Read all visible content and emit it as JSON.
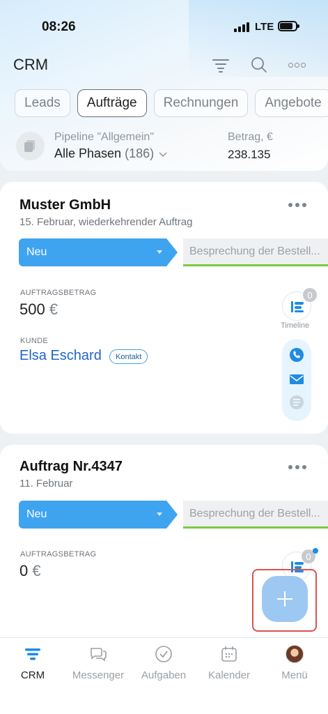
{
  "status_bar": {
    "time": "08:26",
    "network": "LTE"
  },
  "header": {
    "title": "CRM",
    "icons": {
      "filter": "filter-icon",
      "search": "search-icon",
      "more": "more-icon"
    }
  },
  "tabs": [
    {
      "label": "Leads",
      "active": false
    },
    {
      "label": "Aufträge",
      "active": true
    },
    {
      "label": "Rechnungen",
      "active": false
    },
    {
      "label": "Angebote",
      "active": false
    }
  ],
  "pipeline": {
    "label": "Pipeline \"Allgemein\"",
    "value": "Alle Phasen",
    "count": "(186)",
    "amount_label": "Betrag, €",
    "amount_value": "238.135"
  },
  "deals": [
    {
      "title": "Muster GmbH",
      "subtitle": "15. Februar, wiederkehrender Auftrag",
      "stage": "Neu",
      "next_stage": "Besprechung der Bestell...",
      "amount_label": "AUFTRAGSBETRAG",
      "amount": "500",
      "currency": "€",
      "client_label": "KUNDE",
      "client_name": "Elsa Eschard",
      "client_badge": "Kontakt",
      "timeline_count": "0",
      "timeline_label": "Timeline"
    },
    {
      "title": "Auftrag Nr.4347",
      "subtitle": "11. Februar",
      "stage": "Neu",
      "next_stage": "Besprechung der Bestell...",
      "amount_label": "AUFTRAGSBETRAG",
      "amount": "0",
      "currency": "€",
      "timeline_count": "0"
    }
  ],
  "bottom_nav": [
    {
      "label": "CRM",
      "icon": "crm-icon",
      "active": true
    },
    {
      "label": "Messenger",
      "icon": "chat-icon",
      "active": false
    },
    {
      "label": "Aufgaben",
      "icon": "check-circle-icon",
      "active": false
    },
    {
      "label": "Kalender",
      "icon": "calendar-icon",
      "active": false
    },
    {
      "label": "Menü",
      "icon": "avatar",
      "active": false
    }
  ],
  "colors": {
    "accent_blue": "#3fa4ef",
    "link_blue": "#2065c9",
    "progress_green": "#7ac943",
    "highlight_red": "#d9534f"
  }
}
